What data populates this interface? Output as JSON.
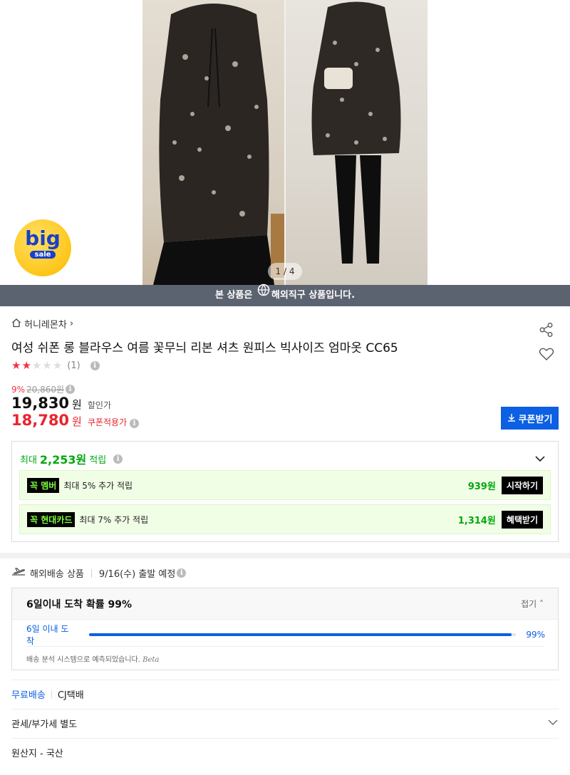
{
  "hero": {
    "page_indicator": "1 / 4",
    "badge": {
      "big": "big",
      "sale": "sale"
    }
  },
  "overseas_notice": {
    "prefix": "본 상품은",
    "emphasis": "해외직구",
    "suffix": "상품입니다."
  },
  "seller": {
    "name": "허니레몬차",
    "chevron": "›"
  },
  "product": {
    "title": "여성 쉬폰 롱 블라우스 여름 꽃무늬 리본 셔츠 원피스 빅사이즈 엄마옷 CC65",
    "rating": {
      "stars_filled": 2,
      "stars_total": 5,
      "count": "(1)"
    }
  },
  "pricing": {
    "discount_rate": "9%",
    "original_price": "20,860원",
    "sale_price": "19,830",
    "sale_unit": "원",
    "sale_label": "할인가",
    "coupon_price": "18,780",
    "coupon_unit": "원",
    "coupon_label": "쿠폰적용가",
    "coupon_button": "쿠폰받기"
  },
  "points": {
    "prefix": "최대",
    "amount": "2,253원",
    "suffix": "적립",
    "offers": [
      {
        "tag": "멤버",
        "brand": "꼭",
        "text": "최대 5% 추가 적립",
        "amount": "939원",
        "action": "시작하기"
      },
      {
        "tag": "현대카드",
        "brand": "꼭",
        "text": "최대 7% 추가 적립",
        "amount": "1,314원",
        "action": "혜택받기"
      }
    ]
  },
  "shipping": {
    "type": "해외배송 상품",
    "departure": "9/16(수) 출발 예정",
    "arrival_title": "6일이내 도착 확률 99%",
    "fold_label": "접기",
    "progress_label": "6일 이내 도착",
    "progress_percent": "99%",
    "progress_value": 0.99,
    "note": "배송 분석 시스템으로 예측되었습니다.",
    "note_beta": "Beta"
  },
  "delivery": {
    "free_label": "무료배송",
    "carrier": "CJ택배"
  },
  "tax": {
    "label": "관세/부가세 별도"
  },
  "origin": {
    "label": "원산지 - 국산"
  },
  "colors": {
    "accent_blue": "#0b60e3",
    "price_red": "#e8242f",
    "points_green": "#00a80e",
    "notice_bar": "#5c6370"
  }
}
